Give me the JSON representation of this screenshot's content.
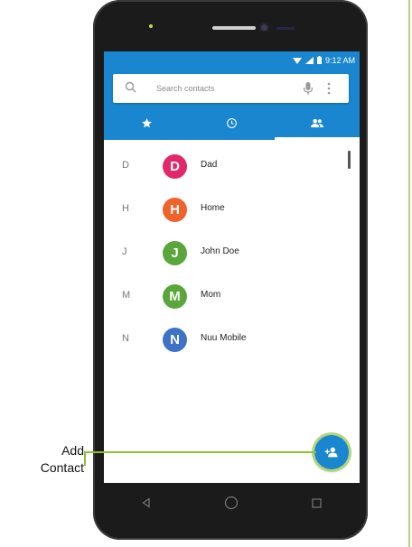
{
  "status_bar": {
    "time": "9:12 AM"
  },
  "search": {
    "placeholder": "Search contacts"
  },
  "tabs": [
    {
      "id": "favorites",
      "icon": "star-icon",
      "active": false
    },
    {
      "id": "recents",
      "icon": "clock-icon",
      "active": false
    },
    {
      "id": "contacts",
      "icon": "people-icon",
      "active": true
    }
  ],
  "contacts": [
    {
      "letter": "D",
      "initial": "D",
      "name": "Dad",
      "color": "#e0286a"
    },
    {
      "letter": "H",
      "initial": "H",
      "name": "Home",
      "color": "#f0622a"
    },
    {
      "letter": "J",
      "initial": "J",
      "name": "John Doe",
      "color": "#5aa63a"
    },
    {
      "letter": "M",
      "initial": "M",
      "name": "Mom",
      "color": "#5aa63a"
    },
    {
      "letter": "N",
      "initial": "N",
      "name": "Nuu Mobile",
      "color": "#3d72c8"
    }
  ],
  "fab": {
    "icon": "add-contact-icon"
  },
  "callout": {
    "line1": "Add",
    "line2": "Contact"
  },
  "colors": {
    "accent": "#1a86cf",
    "callout": "#8dbf3e"
  }
}
